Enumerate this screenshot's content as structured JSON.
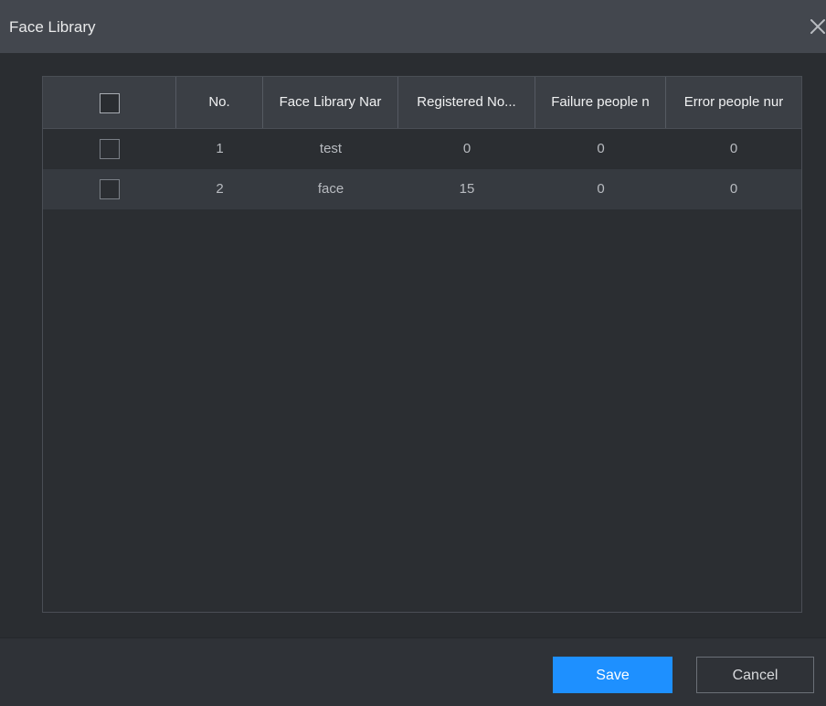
{
  "dialog": {
    "title": "Face Library",
    "close_icon": "close-icon"
  },
  "table": {
    "headers": [
      "",
      "No.",
      "Face Library Nar",
      "Registered No...",
      "Failure people n",
      "Error people nur"
    ],
    "rows": [
      {
        "no": "1",
        "name": "test",
        "registered": "0",
        "failure": "0",
        "error": "0"
      },
      {
        "no": "2",
        "name": "face",
        "registered": "15",
        "failure": "0",
        "error": "0"
      }
    ]
  },
  "footer": {
    "save_label": "Save",
    "cancel_label": "Cancel"
  },
  "colors": {
    "accent": "#1e90ff",
    "titlebar": "#43474e",
    "body": "#2b2e33",
    "header": "#3b3f45",
    "alt_row": "#363a40"
  }
}
